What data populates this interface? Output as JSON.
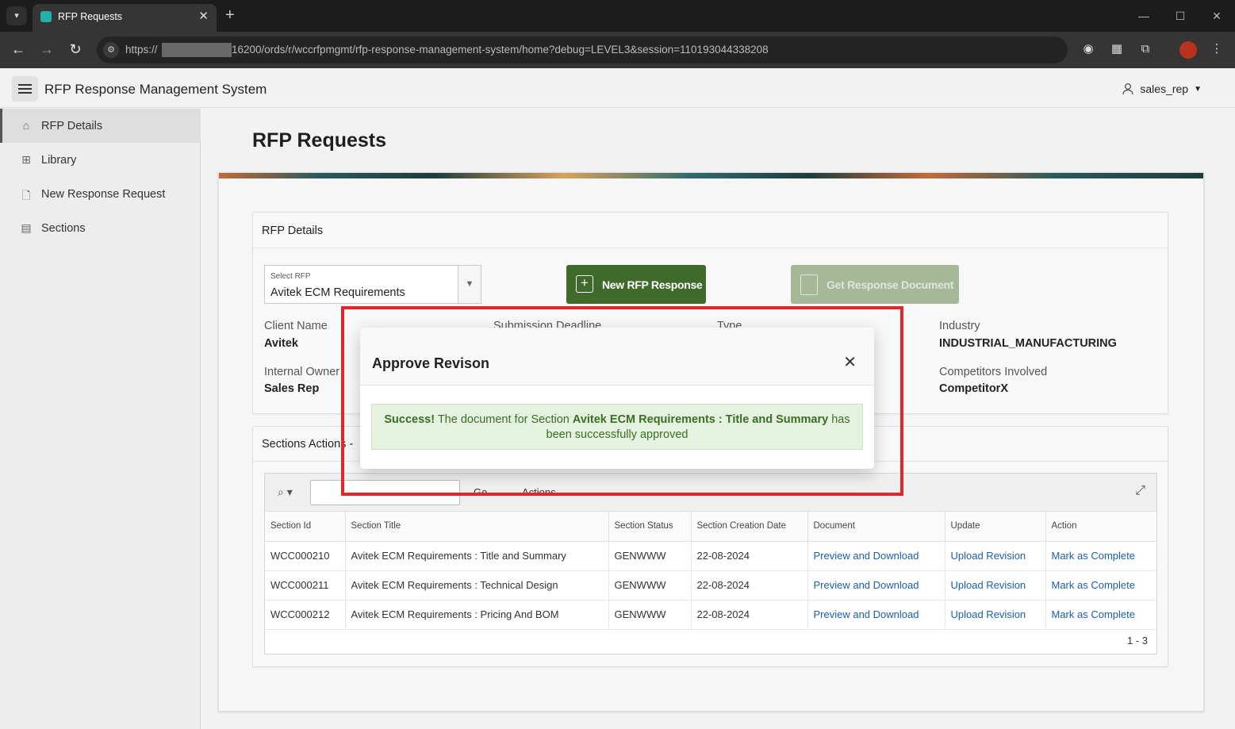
{
  "browser": {
    "tab_title": "RFP Requests",
    "url_prefix": "https://",
    "url_rest": "16200/ords/r/wccrfpmgmt/rfp-response-management-system/home?debug=LEVEL3&session=110193044338208",
    "new_tab_glyph": "+",
    "close_glyph": "✕"
  },
  "app": {
    "title": "RFP Response Management System",
    "user": "sales_rep"
  },
  "sidebar": {
    "items": [
      {
        "label": "RFP Details",
        "icon": "home-icon"
      },
      {
        "label": "Library",
        "icon": "library-icon"
      },
      {
        "label": "New Response Request",
        "icon": "new-document-icon"
      },
      {
        "label": "Sections",
        "icon": "table-icon"
      }
    ]
  },
  "page": {
    "title": "RFP Requests"
  },
  "details": {
    "region_title": "RFP Details",
    "select_label": "Select RFP",
    "select_value": "Avitek ECM Requirements",
    "new_response_label": "New RFP Response",
    "get_document_label": "Get Response Document",
    "client_name_label": "Client Name",
    "client_name_value": "Avitek",
    "submission_label": "Submission Deadline",
    "type_label": "Type",
    "industry_label": "Industry",
    "industry_value": "INDUSTRIAL_MANUFACTURING",
    "owner_label": "Internal Owner",
    "owner_value": "Sales Rep",
    "competitors_label": "Competitors Involved",
    "competitors_value": "CompetitorX"
  },
  "sections_region": {
    "title": "Sections Actions -",
    "go_label": "Go",
    "actions_label": "Actions",
    "columns": [
      "Section Id",
      "Section Title",
      "Section Status",
      "Section Creation Date",
      "Document",
      "Update",
      "Action"
    ],
    "rows": [
      [
        "WCC000210",
        "Avitek ECM Requirements : Title and Summary",
        "GENWWW",
        "22-08-2024",
        "Preview and Download",
        "Upload Revision",
        "Mark as Complete"
      ],
      [
        "WCC000211",
        "Avitek ECM Requirements : Technical Design",
        "GENWWW",
        "22-08-2024",
        "Preview and Download",
        "Upload Revision",
        "Mark as Complete"
      ],
      [
        "WCC000212",
        "Avitek ECM Requirements : Pricing And BOM",
        "GENWWW",
        "22-08-2024",
        "Preview and Download",
        "Upload Revision",
        "Mark as Complete"
      ]
    ],
    "pagination": "1 - 3"
  },
  "dialog": {
    "title": "Approve Revison",
    "alert_strong": "Success!",
    "alert_text_1": " The document for Section ",
    "alert_section": "Avitek ECM Requirements : Title and Summary",
    "alert_text_2": " has been successfully approved"
  },
  "colors": {
    "primary_button": "#3f6a2a",
    "disabled_button": "#a7b898",
    "link": "#1a5fa8",
    "success_bg": "#e6f2e0",
    "highlight": "#e3262b"
  }
}
